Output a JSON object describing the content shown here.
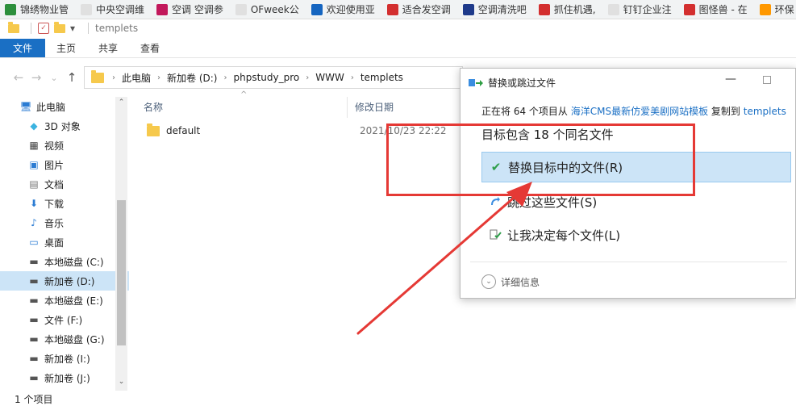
{
  "bookmarks": [
    {
      "label": "锦绣物业管",
      "color": "#2d8f3c"
    },
    {
      "label": "中央空调维",
      "color": "#e0e0e0"
    },
    {
      "label": "空调 空调参",
      "color": "#c2185b"
    },
    {
      "label": "OFweek公",
      "color": "#e0e0e0"
    },
    {
      "label": "欢迎使用亚",
      "color": "#1565c0"
    },
    {
      "label": "适合发空调",
      "color": "#d32f2f"
    },
    {
      "label": "空调清洗吧",
      "color": "#1e3a8a"
    },
    {
      "label": "抓住机遇,",
      "color": "#d32f2f"
    },
    {
      "label": "钉钉企业注",
      "color": "#e0e0e0"
    },
    {
      "label": "图怪兽 - 在",
      "color": "#d32f2f"
    },
    {
      "label": "环保",
      "color": "#ff9800"
    }
  ],
  "window": {
    "title": "templets",
    "title_menu": "▾"
  },
  "ribbon": {
    "tabs": [
      "文件",
      "主页",
      "共享",
      "查看"
    ]
  },
  "nav": {
    "back": "←",
    "forward": "→",
    "down": "⌄",
    "up": "↑"
  },
  "address": {
    "crumbs": [
      "此电脑",
      "新加卷 (D:)",
      "phpstudy_pro",
      "WWW",
      "templets"
    ]
  },
  "sidebar": {
    "items": [
      {
        "label": "此电脑",
        "icon": "computer-icon",
        "glyph": "🖥",
        "top": true
      },
      {
        "label": "3D 对象",
        "icon": "3d-objects-icon",
        "glyph": "◆"
      },
      {
        "label": "视频",
        "icon": "video-icon",
        "glyph": "▦"
      },
      {
        "label": "图片",
        "icon": "picture-icon",
        "glyph": "▣"
      },
      {
        "label": "文档",
        "icon": "document-icon",
        "glyph": "▤"
      },
      {
        "label": "下载",
        "icon": "download-icon",
        "glyph": "⬇"
      },
      {
        "label": "音乐",
        "icon": "music-icon",
        "glyph": "♪"
      },
      {
        "label": "桌面",
        "icon": "desktop-icon",
        "glyph": "▭"
      },
      {
        "label": "本地磁盘 (C:)",
        "icon": "drive-icon",
        "glyph": "▬"
      },
      {
        "label": "新加卷 (D:)",
        "icon": "drive-icon",
        "glyph": "▬",
        "selected": true
      },
      {
        "label": "本地磁盘 (E:)",
        "icon": "drive-icon",
        "glyph": "▬"
      },
      {
        "label": "文件 (F:)",
        "icon": "drive-icon",
        "glyph": "▬"
      },
      {
        "label": "本地磁盘 (G:)",
        "icon": "drive-icon",
        "glyph": "▬"
      },
      {
        "label": "新加卷 (I:)",
        "icon": "drive-icon",
        "glyph": "▬"
      },
      {
        "label": "新加卷 (J:)",
        "icon": "drive-icon",
        "glyph": "▬"
      }
    ]
  },
  "filelist": {
    "col_name": "名称",
    "col_date": "修改日期",
    "rows": [
      {
        "name": "default",
        "date": "2021/10/23 22:22"
      }
    ]
  },
  "status": {
    "text": "1 个项目"
  },
  "dialog": {
    "title": "替换或跳过文件",
    "info_prefix": "正在将 64 个项目从",
    "info_source": "海洋CMS最新仿爱美剧网站模板",
    "info_mid": "复制到",
    "info_target": "templets",
    "heading": "目标包含 18 个同名文件",
    "options": [
      {
        "label": "替换目标中的文件(R)",
        "icon": "checkmark-icon"
      },
      {
        "label": "跳过这些文件(S)",
        "icon": "skip-icon"
      },
      {
        "label": "让我决定每个文件(L)",
        "icon": "decide-icon"
      }
    ],
    "details": "详细信息",
    "minimize": "—"
  },
  "colors": {
    "accent": "#1a6fc4",
    "highlight": "#cce4f7",
    "annotation": "#e53935"
  }
}
